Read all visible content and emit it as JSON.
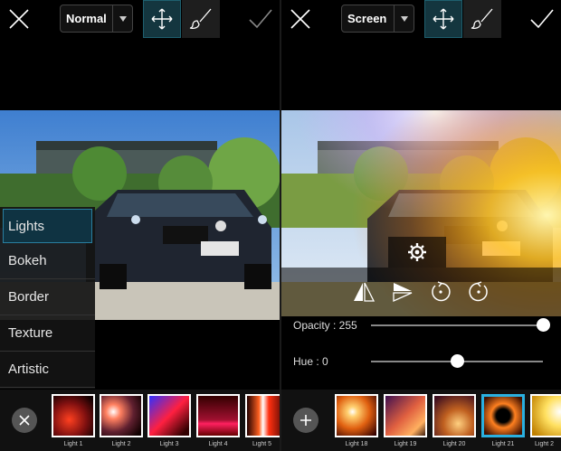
{
  "left": {
    "blend_mode": "Normal",
    "categories": [
      "Lights",
      "Bokeh",
      "Border",
      "Texture",
      "Artistic"
    ],
    "selected_category": "Lights",
    "thumbnails": [
      "Light 1",
      "Light 2",
      "Light 3",
      "Light 4",
      "Light 5"
    ],
    "icons": {
      "close": "close-icon",
      "confirm": "check-icon",
      "dropdown": "chevron-down-icon",
      "move": "move-icon",
      "brush": "brush-icon",
      "remove": "close-circle-icon"
    }
  },
  "right": {
    "blend_mode": "Screen",
    "opacity_label": "Opacity : 255",
    "opacity_value": 255,
    "opacity_max": 255,
    "hue_label": "Hue : 0",
    "hue_value": 0,
    "thumbnails": [
      "Light 18",
      "Light 19",
      "Light 20",
      "Light 21",
      "Light 2"
    ],
    "selected_thumbnail": "Light 21",
    "icons": {
      "close": "close-icon",
      "confirm": "check-icon",
      "dropdown": "chevron-down-icon",
      "move": "move-icon",
      "brush": "brush-icon",
      "add": "plus-circle-icon",
      "settings": "gear-icon",
      "flip_h": "flip-horizontal-icon",
      "flip_v": "flip-vertical-icon",
      "rotate_left": "rotate-left-icon",
      "rotate_right": "rotate-right-icon"
    }
  },
  "colors": {
    "accent": "#2ab0e0",
    "selected_bg": "#0f3342"
  }
}
